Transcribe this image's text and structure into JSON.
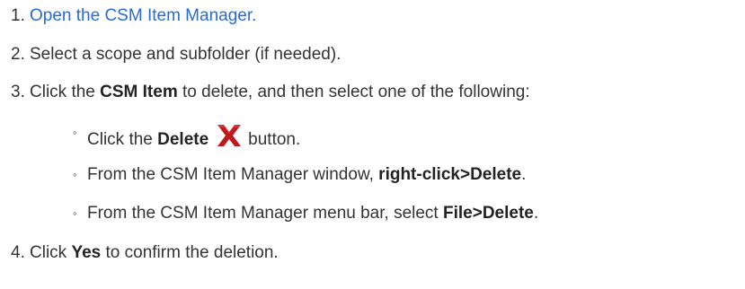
{
  "steps": [
    {
      "number": "1.",
      "link_text": "Open the CSM Item Manager."
    },
    {
      "number": "2.",
      "text": "Select a scope and subfolder (if needed)."
    },
    {
      "number": "3.",
      "pre": "Click the ",
      "bold": "CSM Item",
      "post": " to delete, and then select one of the following:"
    },
    {
      "number": "4.",
      "pre": "Click ",
      "bold": "Yes",
      "post": " to confirm the deletion."
    }
  ],
  "substeps": [
    {
      "bullet": "◦",
      "pre": "Click the ",
      "bold": "Delete",
      "icon": "delete-x-icon",
      "post": "button."
    },
    {
      "bullet": "◦",
      "pre": "From the CSM Item Manager window, ",
      "bold": "right-click>Delete",
      "post": "."
    },
    {
      "bullet": "◦",
      "pre": "From the CSM Item Manager menu bar, select ",
      "bold": "File>Delete",
      "post": "."
    }
  ],
  "colors": {
    "link": "#2a6ad8",
    "text": "#333333",
    "delete_icon": "#c0181c"
  }
}
